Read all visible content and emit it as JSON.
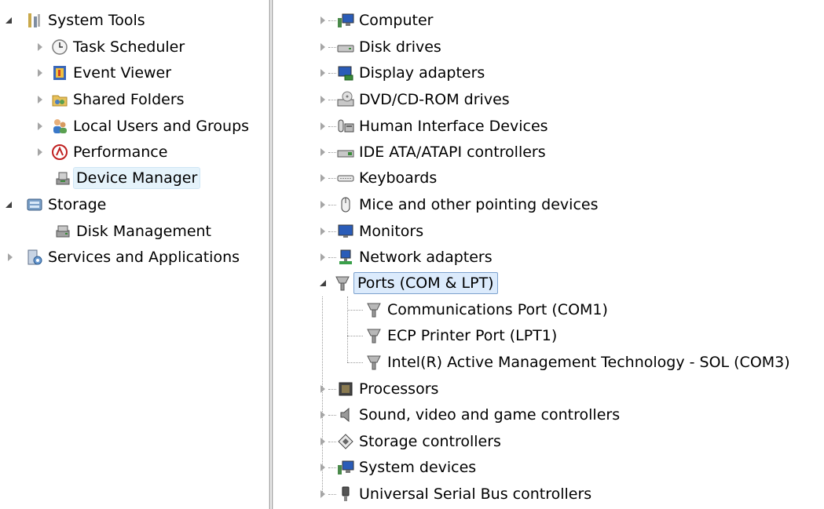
{
  "left_tree": {
    "system_tools": "System Tools",
    "task_scheduler": "Task Scheduler",
    "event_viewer": "Event Viewer",
    "shared_folders": "Shared Folders",
    "local_users": "Local Users and Groups",
    "performance": "Performance",
    "device_manager": "Device Manager",
    "storage": "Storage",
    "disk_management": "Disk Management",
    "services": "Services and Applications"
  },
  "devices": {
    "computer": "Computer",
    "disk_drives": "Disk drives",
    "display_adapters": "Display adapters",
    "dvd": "DVD/CD-ROM drives",
    "hid": "Human Interface Devices",
    "ide": "IDE ATA/ATAPI controllers",
    "keyboards": "Keyboards",
    "mice": "Mice and other pointing devices",
    "monitors": "Monitors",
    "network": "Network adapters",
    "ports": "Ports (COM & LPT)",
    "port_com1": "Communications Port (COM1)",
    "port_lpt1": "ECP Printer Port (LPT1)",
    "port_com3": "Intel(R) Active Management Technology - SOL (COM3)",
    "processors": "Processors",
    "sound": "Sound, video and game controllers",
    "storage_ctrl": "Storage controllers",
    "system_devices": "System devices",
    "usb": "Universal Serial Bus controllers"
  }
}
